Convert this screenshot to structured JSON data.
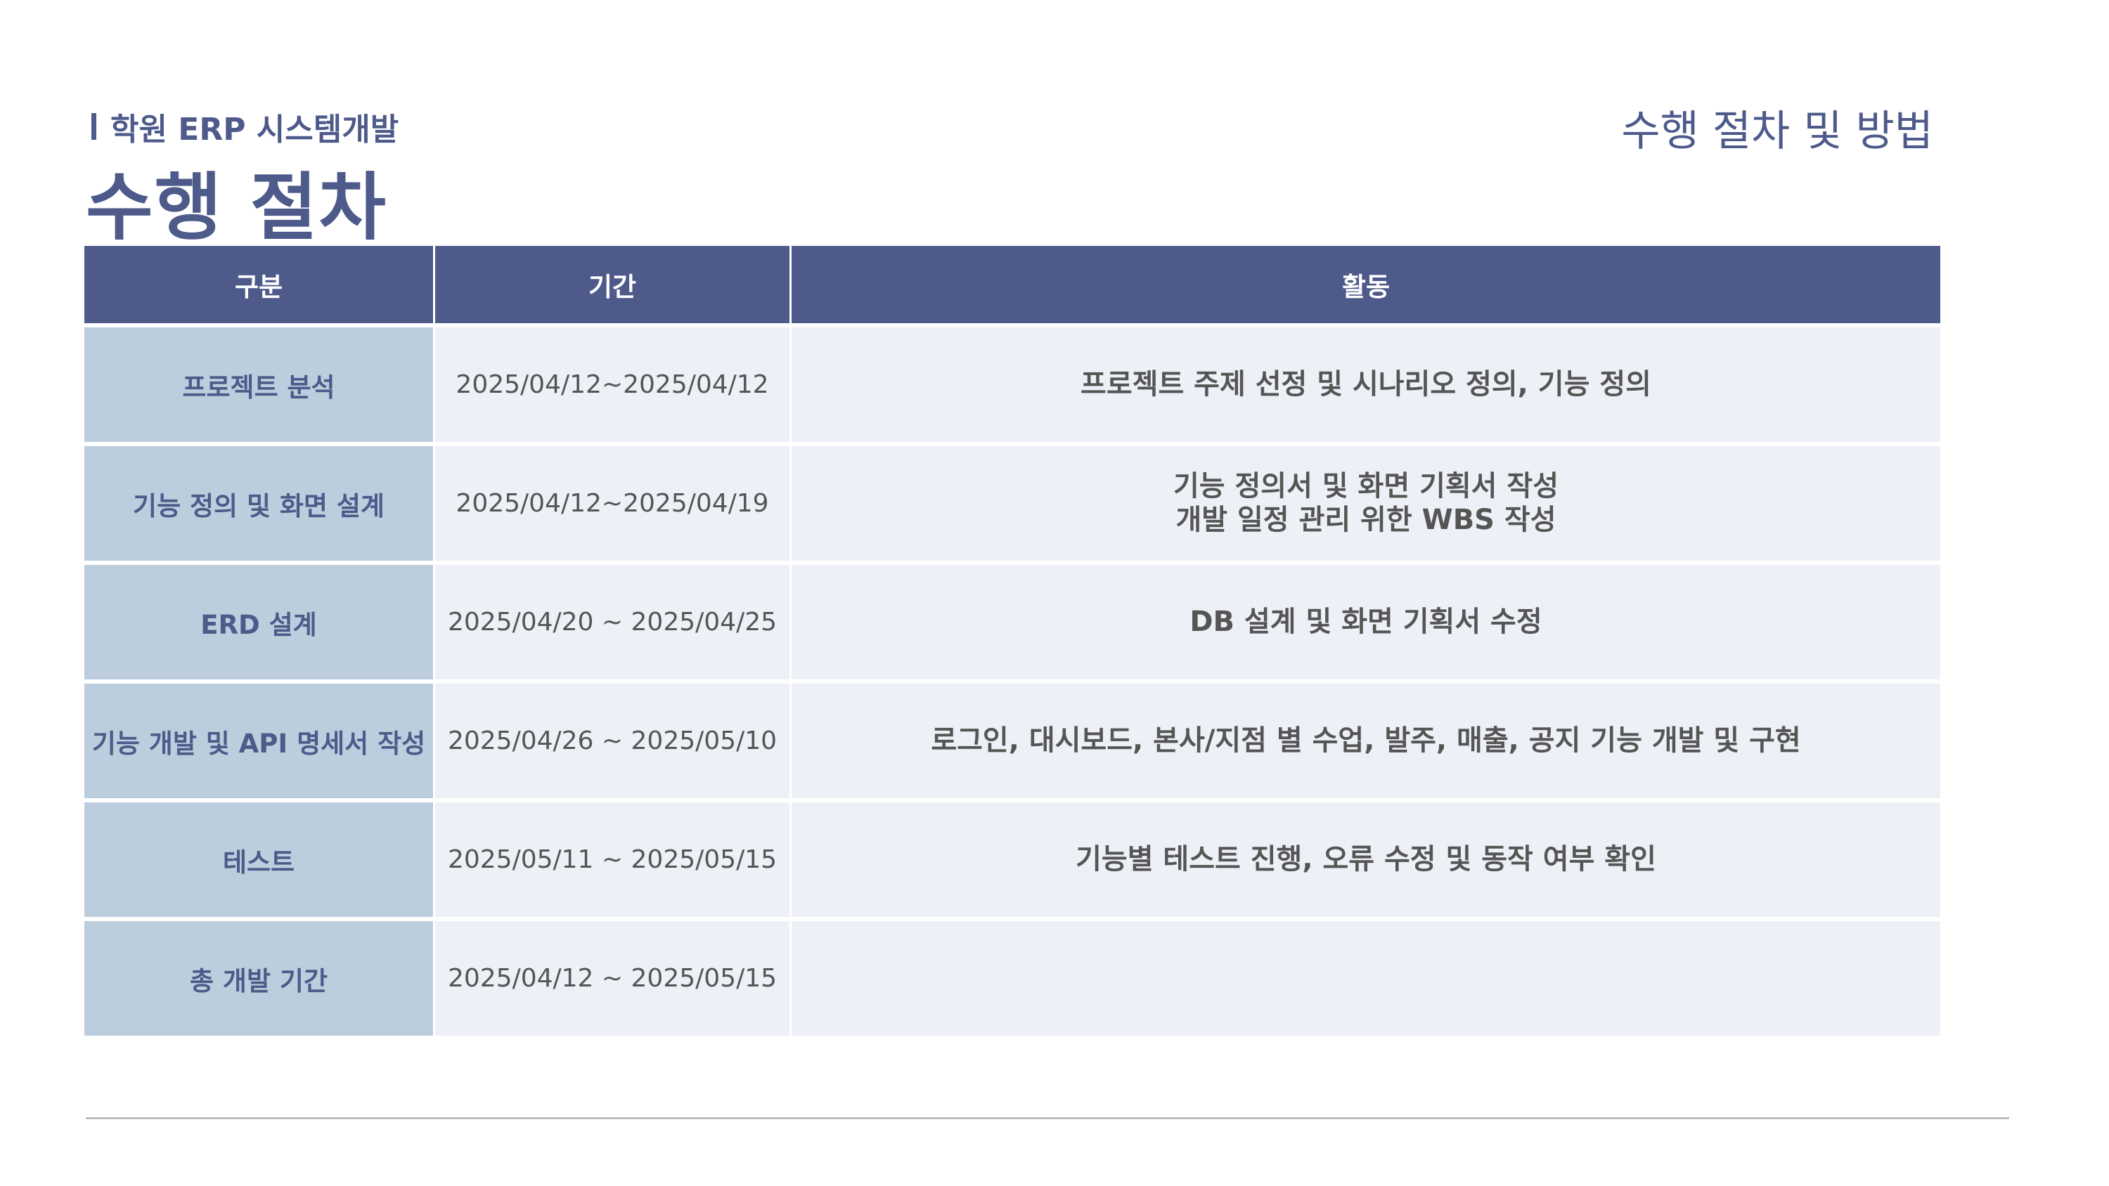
{
  "header": {
    "subtitle": "학원 ERP 시스템개발",
    "title": "수행 절차",
    "section_label": "수행 절차 및 방법"
  },
  "table": {
    "columns": [
      "구분",
      "기간",
      "활동"
    ],
    "rows": [
      {
        "category": "프로젝트 분석",
        "period": "2025/04/12~2025/04/12",
        "activity": [
          "프로젝트 주제 선정 및 시나리오 정의, 기능 정의"
        ]
      },
      {
        "category": "기능 정의 및 화면 설계",
        "period": "2025/04/12~2025/04/19",
        "activity": [
          "기능 정의서 및 화면 기획서 작성",
          "개발 일정 관리 위한 WBS 작성"
        ]
      },
      {
        "category": "ERD 설계",
        "period": "2025/04/20 ~ 2025/04/25",
        "activity": [
          "DB 설계 및 화면 기획서 수정"
        ]
      },
      {
        "category": "기능 개발 및 API 명세서 작성",
        "period": "2025/04/26 ~ 2025/05/10",
        "activity": [
          "로그인, 대시보드, 본사/지점 별 수업, 발주, 매출, 공지 기능 개발 및 구현"
        ]
      },
      {
        "category": "테스트",
        "period": "2025/05/11 ~ 2025/05/15",
        "activity": [
          "기능별 테스트 진행, 오류 수정 및 동작 여부 확인"
        ]
      },
      {
        "category": "총 개발 기간",
        "period": "2025/04/12 ~ 2025/05/15",
        "activity": []
      }
    ]
  },
  "colors": {
    "accent": "#4d5a8a",
    "category_bg": "#bccddd",
    "cell_bg": "#edf0f6"
  }
}
